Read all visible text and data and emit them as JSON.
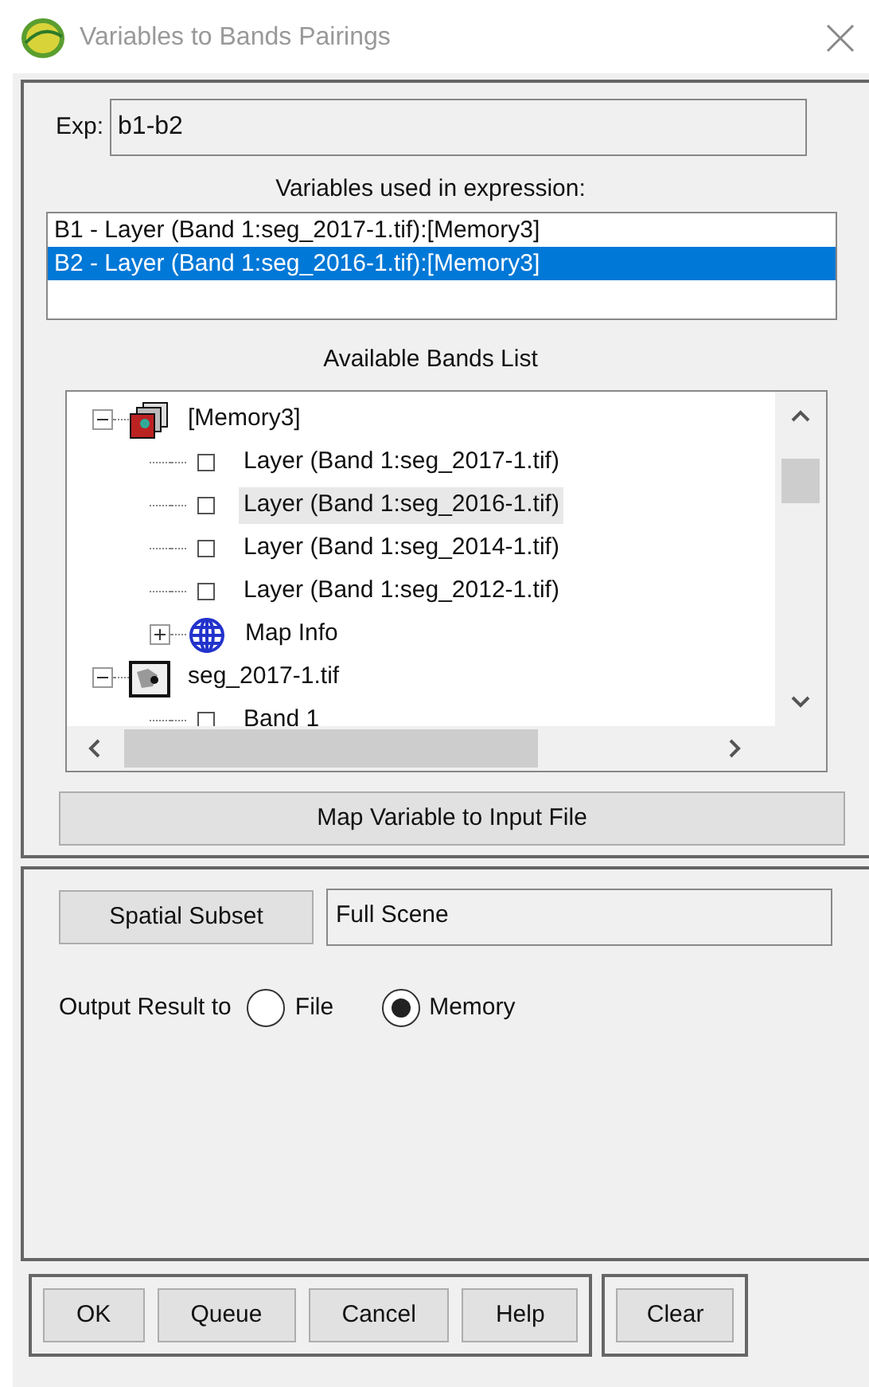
{
  "window": {
    "title": "Variables to Bands Pairings"
  },
  "expression": {
    "label": "Exp:",
    "value": "b1-b2"
  },
  "variables": {
    "heading": "Variables used in expression:",
    "items": [
      {
        "label": "B1 - Layer (Band 1:seg_2017-1.tif):[Memory3]",
        "selected": false
      },
      {
        "label": "B2 - Layer (Band 1:seg_2016-1.tif):[Memory3]",
        "selected": true
      }
    ]
  },
  "bands": {
    "heading": "Available Bands List",
    "tree": [
      {
        "label": "[Memory3]",
        "kind": "stack",
        "expanded": true,
        "selected": false,
        "children": [
          {
            "label": "Layer (Band 1:seg_2017-1.tif)",
            "kind": "band",
            "selected": false
          },
          {
            "label": "Layer (Band 1:seg_2016-1.tif)",
            "kind": "band",
            "selected": true
          },
          {
            "label": "Layer (Band 1:seg_2014-1.tif)",
            "kind": "band",
            "selected": false
          },
          {
            "label": "Layer (Band 1:seg_2012-1.tif)",
            "kind": "band",
            "selected": false
          },
          {
            "label": "Map Info",
            "kind": "globe",
            "expanded": false,
            "selected": false
          }
        ]
      },
      {
        "label": "seg_2017-1.tif",
        "kind": "image",
        "expanded": true,
        "selected": false,
        "children": [
          {
            "label": "Band 1",
            "kind": "band",
            "selected": false
          }
        ]
      }
    ]
  },
  "map_button": "Map Variable to Input File",
  "spatial_subset": {
    "button": "Spatial Subset",
    "value": "Full Scene"
  },
  "output": {
    "label": "Output Result to",
    "options": [
      {
        "label": "File",
        "selected": false
      },
      {
        "label": "Memory",
        "selected": true
      }
    ]
  },
  "buttons": [
    "OK",
    "Queue",
    "Cancel",
    "Help"
  ],
  "clear_button": "Clear"
}
